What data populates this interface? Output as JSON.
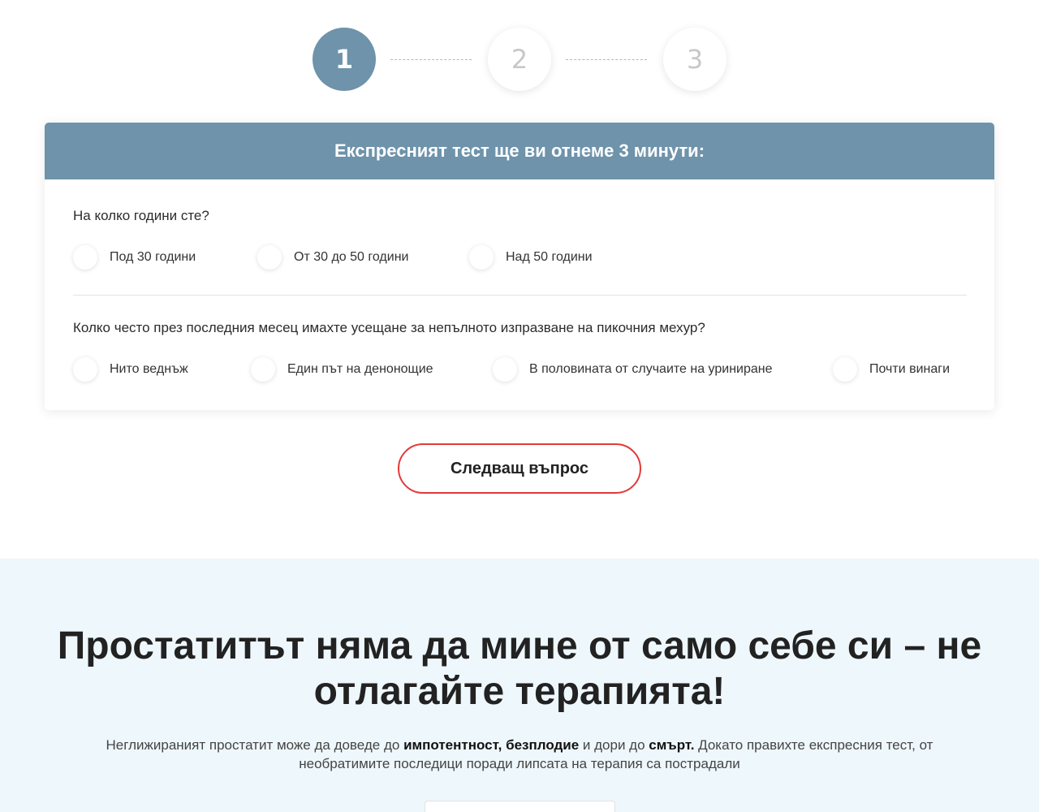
{
  "steps": [
    "1",
    "2",
    "3"
  ],
  "active_step": 1,
  "quiz": {
    "header": "Експресният тест ще ви отнеме 3 минути:",
    "questions": [
      {
        "text": "На колко години сте?",
        "options": [
          "Под 30 години",
          "От 30 до 50 години",
          "Над 50 години"
        ]
      },
      {
        "text": "Колко често през последния месец имахте усещане за непълното изпразване на пикочния мехур?",
        "options": [
          "Нито веднъж",
          "Един път на денонощие",
          "В половината от случаите на уриниране",
          "Почти винаги"
        ]
      }
    ]
  },
  "next_button": "Следващ въпрос",
  "info": {
    "heading_line1": "Простатитът няма да мине от само себе си – не",
    "heading_line2": "отлагайте терапията!",
    "text_part1": "Неглижираният простатит може да доведе до ",
    "text_bold1": "импотентност, безплодие",
    "text_part2": " и дори до ",
    "text_bold2": "смърт.",
    "text_part3": " Докато правихте експресния тест, от",
    "text_line2": "необратимите последици поради липсата на терапия са пострадали"
  },
  "colors": {
    "accent": "#6e93ab",
    "button_border": "#e23a3a",
    "info_background": "#eef7fc"
  }
}
